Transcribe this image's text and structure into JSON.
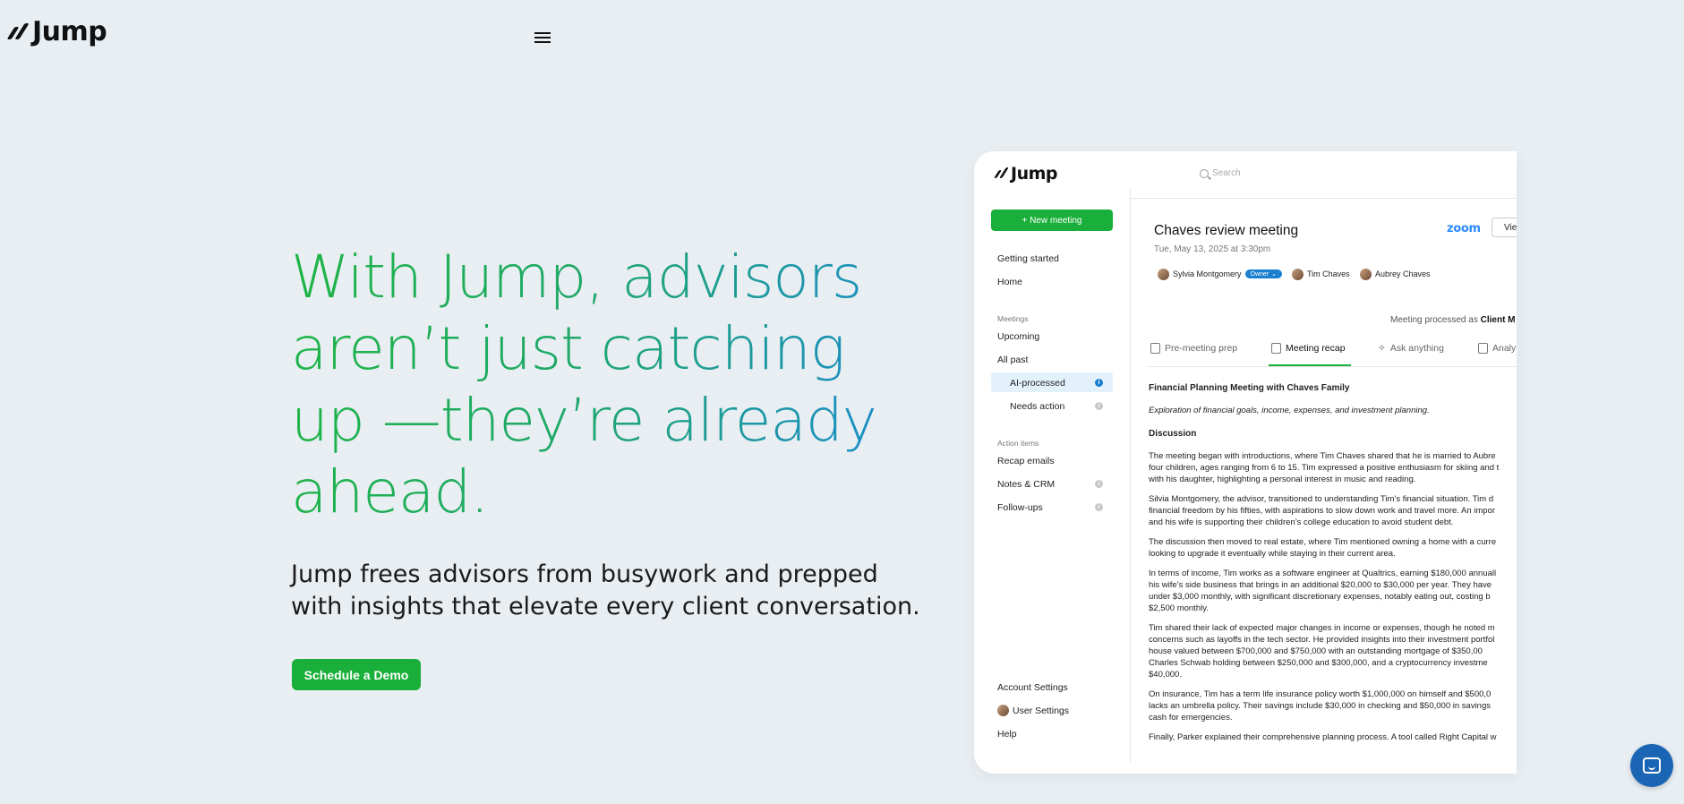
{
  "brand": {
    "name": "Jump"
  },
  "hero": {
    "title": "With Jump, advisors aren’t just catching up —they’re already ahead.",
    "subtitle": "Jump frees advisors from busywork and prepped with insights that elevate every client conversation.",
    "cta_label": "Schedule a Demo"
  },
  "colors": {
    "accent_green": "#1aaf3a",
    "accent_blue": "#1b8fc4",
    "background": "#e9eef2"
  },
  "app": {
    "logo": "Jump",
    "search_placeholder": "Search",
    "new_meeting_label": "+ New meeting",
    "sidebar": {
      "getting_started": "Getting started",
      "home": "Home",
      "meetings_heading": "Meetings",
      "upcoming": "Upcoming",
      "all_past": "All past",
      "ai_processed": "AI-processed",
      "needs_action": "Needs action",
      "action_items_heading": "Action items",
      "recap_emails": "Recap emails",
      "notes_crm": "Notes & CRM",
      "follow_ups": "Follow-ups",
      "account_settings": "Account Settings",
      "user_settings": "User Settings",
      "help": "Help"
    },
    "meeting": {
      "title": "Chaves review meeting",
      "date": "Tue, May 13, 2025 at 3:30pm",
      "provider": "zoom",
      "view_label": "Vie",
      "participants": [
        {
          "name": "Sylvia Montgomery",
          "badge": "Owner"
        },
        {
          "name": "Tim Chaves"
        },
        {
          "name": "Aubrey Chaves"
        }
      ],
      "processed_prefix": "Meeting processed as",
      "processed_value": "Client M"
    },
    "tabs": [
      "Pre-meeting prep",
      "Meeting recap",
      "Ask anything",
      "Analy"
    ],
    "recap": {
      "heading": "Financial Planning Meeting with Chaves Family",
      "summary": "Exploration of financial goals, income, expenses, and investment planning.",
      "section": "Discussion",
      "paragraphs": [
        "The meeting began with introductions, where Tim Chaves shared that he is married to Aubre\nfour children, ages ranging from 6 to 15. Tim expressed a positive enthusiasm for skiing and t\nwith his daughter, highlighting a personal interest in music and reading.",
        "Silvia Montgomery, the advisor, transitioned to understanding Tim’s financial situation. Tim d\nfinancial freedom by his fifties, with aspirations to slow down work and travel more. An impor\nand his wife is supporting their children’s college education to avoid student debt.",
        "The discussion then moved to real estate, where Tim mentioned owning a home with a curre\nlooking to upgrade it eventually while staying in their current area.",
        "In terms of income, Tim works as a software engineer at Qualtrics, earning $180,000 annuall\nhis wife’s side business that brings in an additional $20,000 to $30,000 per year. They have\nunder $3,000 monthly, with significant discretionary expenses, notably eating out, costing b\n$2,500 monthly.",
        "Tim shared their lack of expected major changes in income or expenses, though he noted m\nconcerns such as layoffs in the tech sector. He provided insights into their investment portfol\nhouse valued between $700,000 and $750,000 with an outstanding mortgage of $350,00\nCharles Schwab holding between $250,000 and $300,000, and a cryptocurrency investme\n$40,000.",
        "On insurance, Tim has a term life insurance policy worth $1,000,000 on himself and $500,0\nlacks an umbrella policy. Their savings include $30,000 in checking and $50,000 in savings\ncash for emergencies.",
        "Finally, Parker explained their comprehensive planning process. A tool called Right Capital w"
      ]
    }
  }
}
